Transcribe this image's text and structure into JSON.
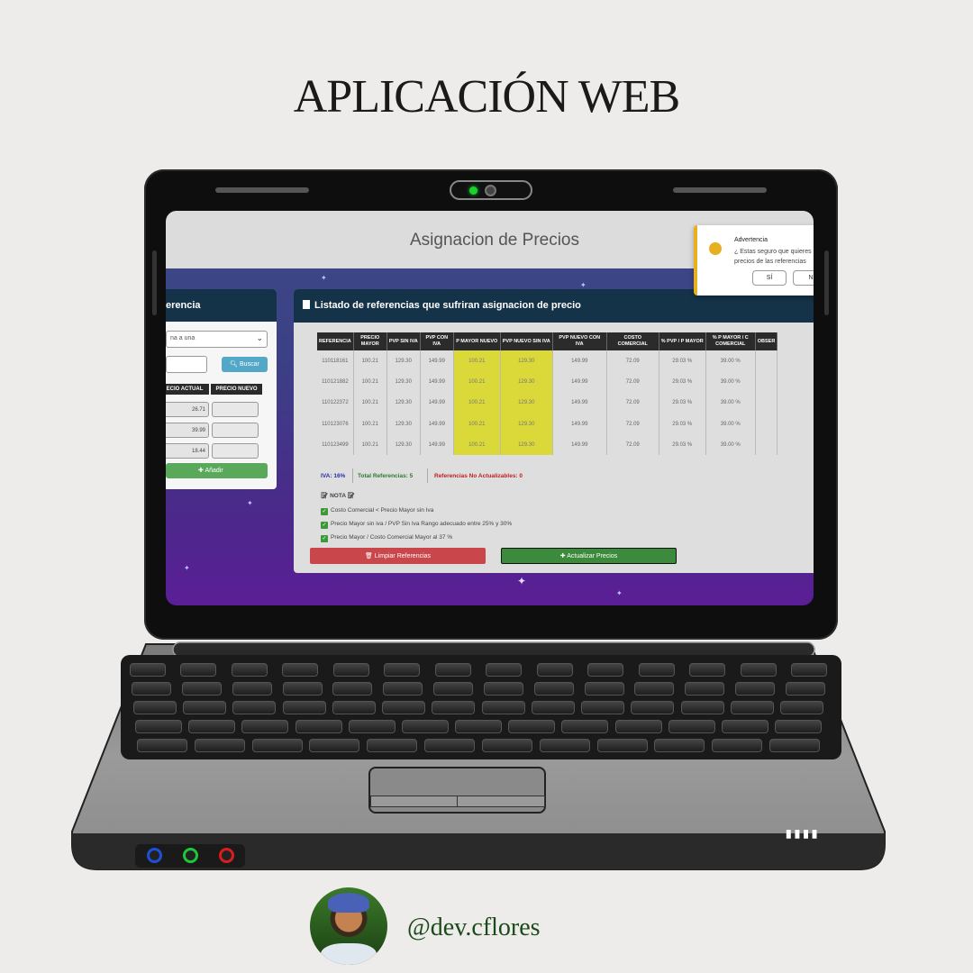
{
  "headline": "APLICACIÓN WEB",
  "app": {
    "title": "Asignacion de Precios"
  },
  "left_panel": {
    "title": "erencia",
    "select_value": "na a una",
    "search_label": "Buscar",
    "columns": [
      "ECIO ACTUAL",
      "PRECIO NUEVO"
    ],
    "current_prices": [
      "26.71",
      "39.99",
      "18.44"
    ],
    "add_label": "Añadir"
  },
  "main_panel": {
    "title": "Listado de referencias que sufriran asignacion de precio",
    "columns": [
      "REFERENCIA",
      "PRECIO MAYOR",
      "PVP SIN IVA",
      "PVP CON IVA",
      "P MAYOR NUEVO",
      "PVP NUEVO SIN IVA",
      "PVP NUEVO CON IVA",
      "COSTO COMERCIAL",
      "% PVP / P MAYOR",
      "% P MAYOR / C COMERCIAL",
      "OBSER"
    ],
    "rows": [
      [
        "110118161",
        "100.21",
        "129.30",
        "149.99",
        "100.21",
        "129.30",
        "149.99",
        "72.09",
        "29.03 %",
        "39.00 %",
        ""
      ],
      [
        "110121882",
        "100.21",
        "129.30",
        "149.99",
        "100.21",
        "129.30",
        "149.99",
        "72.09",
        "29.03 %",
        "39.00 %",
        ""
      ],
      [
        "110122372",
        "100.21",
        "129.30",
        "149.99",
        "100.21",
        "129.30",
        "149.99",
        "72.09",
        "29.03 %",
        "39.00 %",
        ""
      ],
      [
        "110123076",
        "100.21",
        "129.30",
        "149.99",
        "100.21",
        "129.30",
        "149.99",
        "72.09",
        "29.03 %",
        "39.00 %",
        ""
      ],
      [
        "110123499",
        "100.21",
        "129.30",
        "149.99",
        "100.21",
        "129.30",
        "149.99",
        "72.09",
        "29.03 %",
        "39.00 %",
        ""
      ]
    ],
    "iva": "IVA: 16%",
    "total": "Total Referencias: 5",
    "not_updatable": "Referencias No Actualizables: 0",
    "nota_label": "NOTA",
    "notes": [
      "Costo Comercial < Precio Mayor sin Iva",
      "Precio Mayor sin iva / PVP Sin Iva Rango adecuado entre 25% y 30%",
      "Precio Mayor / Costo Comercial Mayor al 37 %"
    ],
    "clear_label": "Limpiar Referencias",
    "update_label": "Actualizar Precios"
  },
  "alert": {
    "title": "Advertencia",
    "message": "¿ Estas seguro que quieres precios de las referencias",
    "yes_label": "SÍ",
    "no_label": "N"
  },
  "colors": {
    "panel_header": "#143248",
    "highlight": "#dbd93a",
    "warning": "#e7b021",
    "danger": "#c9474a",
    "success": "#3c8a3c"
  },
  "author_handle": "@dev.cflores"
}
